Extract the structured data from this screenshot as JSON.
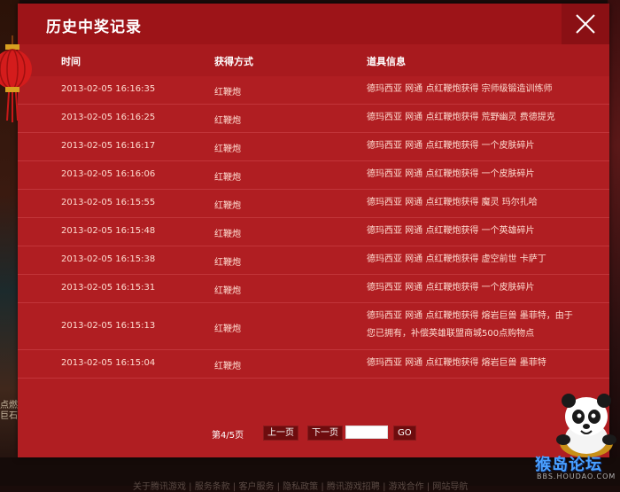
{
  "modal": {
    "title": "历史中奖记录",
    "close_icon": "close-icon"
  },
  "table": {
    "headers": [
      "时间",
      "获得方式",
      "道具信息"
    ],
    "rows": [
      {
        "time": "2013-02-05 16:16:35",
        "method": "红鞭炮",
        "item": "德玛西亚 网通 点红鞭炮获得 宗师级锻造训练师"
      },
      {
        "time": "2013-02-05 16:16:25",
        "method": "红鞭炮",
        "item": "德玛西亚 网通 点红鞭炮获得 荒野幽灵 费德提克"
      },
      {
        "time": "2013-02-05 16:16:17",
        "method": "红鞭炮",
        "item": "德玛西亚 网通 点红鞭炮获得 一个皮肤碎片"
      },
      {
        "time": "2013-02-05 16:16:06",
        "method": "红鞭炮",
        "item": "德玛西亚 网通 点红鞭炮获得 一个皮肤碎片"
      },
      {
        "time": "2013-02-05 16:15:55",
        "method": "红鞭炮",
        "item": "德玛西亚 网通 点红鞭炮获得 魔灵 玛尔扎哈"
      },
      {
        "time": "2013-02-05 16:15:48",
        "method": "红鞭炮",
        "item": "德玛西亚 网通 点红鞭炮获得 一个英雄碎片"
      },
      {
        "time": "2013-02-05 16:15:38",
        "method": "红鞭炮",
        "item": "德玛西亚 网通 点红鞭炮获得 虚空前世 卡萨丁"
      },
      {
        "time": "2013-02-05 16:15:31",
        "method": "红鞭炮",
        "item": "德玛西亚 网通 点红鞭炮获得 一个皮肤碎片"
      },
      {
        "time": "2013-02-05 16:15:13",
        "method": "红鞭炮",
        "item": "德玛西亚 网通 点红鞭炮获得 熔岩巨兽 墨菲特，由于您已拥有，补偿英雄联盟商城500点购物点"
      },
      {
        "time": "2013-02-05 16:15:04",
        "method": "红鞭炮",
        "item": "德玛西亚 网通 点红鞭炮获得 熔岩巨兽 墨菲特"
      }
    ]
  },
  "pager": {
    "page_info": "第4/5页",
    "prev_label": "上一页",
    "next_label": "下一页",
    "page_input_value": "",
    "go_label": "GO"
  },
  "background": {
    "edge_text": "点燃 巨石",
    "footer_text": "关于腾讯游戏 | 服务条款 | 客户服务 | 隐私政策 | 腾讯游戏招聘 | 游戏合作 | 网站导航"
  },
  "watermark": {
    "name": "猴岛论坛",
    "url": "BBS.HOUDAO.COM"
  },
  "colors": {
    "modal_bg": "#b01e22",
    "header_bg": "#9d1418",
    "row_text": "#ffdcd0",
    "row_border": "#c2353a"
  }
}
